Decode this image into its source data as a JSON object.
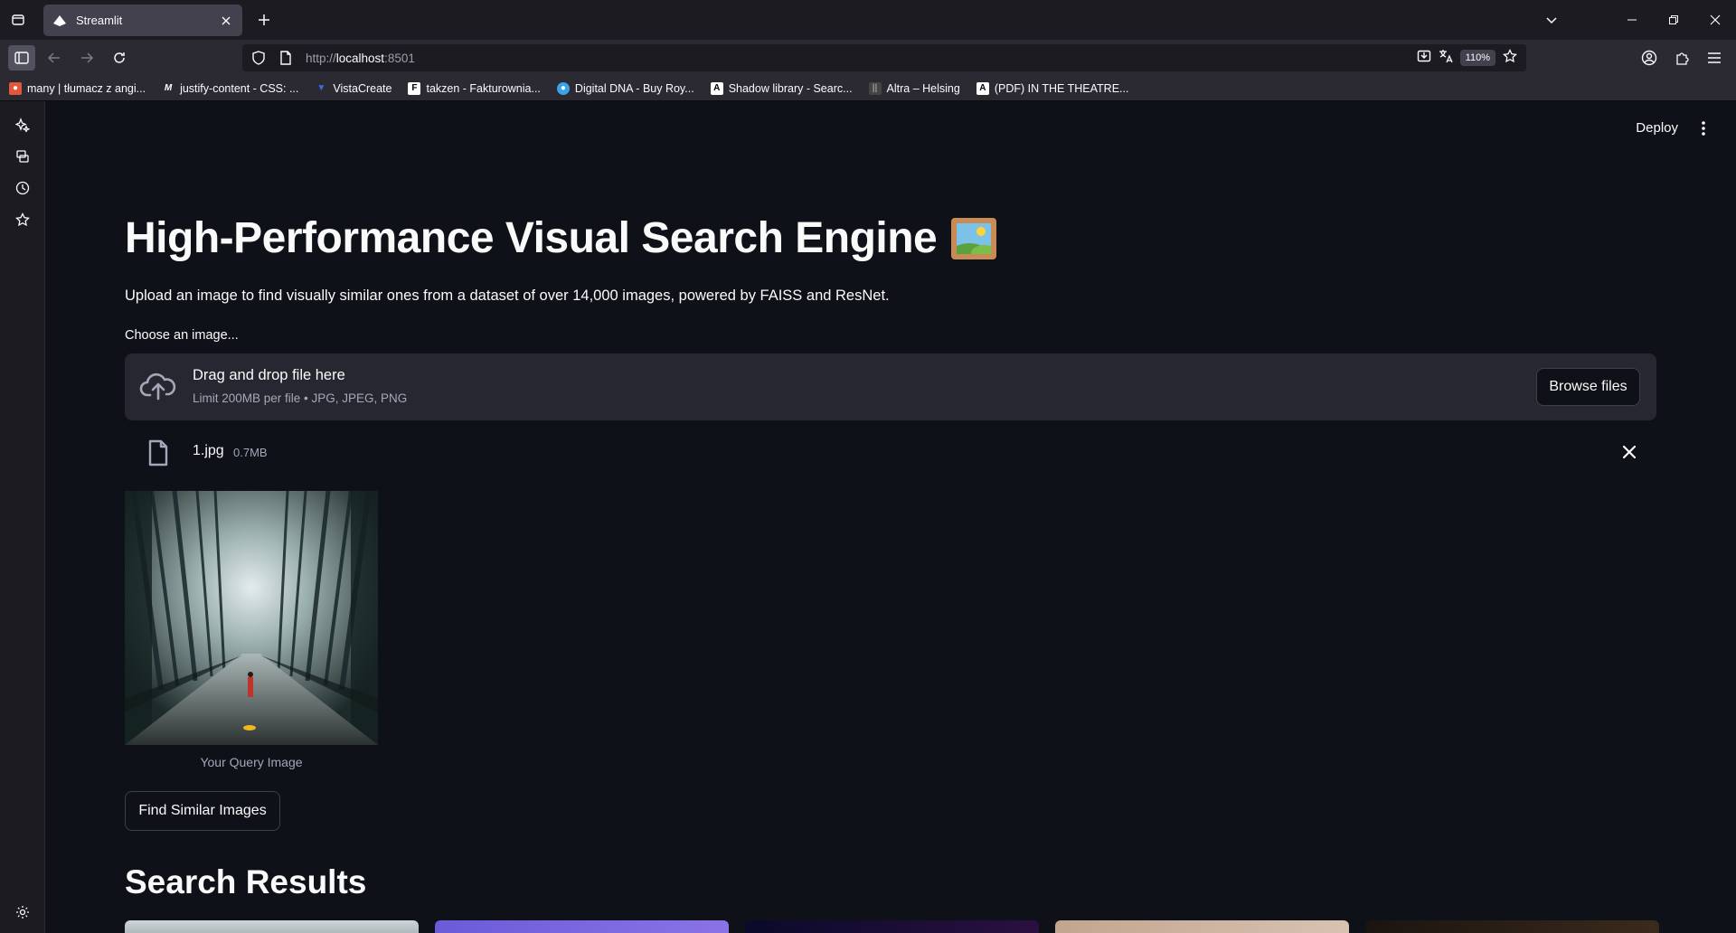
{
  "browser": {
    "tab_title": "Streamlit",
    "url_host": "http://",
    "url_main": "localhost",
    "url_port": ":8501",
    "zoom": "110%",
    "bookmarks": [
      {
        "label": "many | tłumacz z angi...",
        "color": "#e2563b"
      },
      {
        "label": "justify-content - CSS: ...",
        "color": "#ffffff"
      },
      {
        "label": "VistaCreate",
        "color": "#2f6fea"
      },
      {
        "label": "takzen - Fakturownia...",
        "color": "#ffffff"
      },
      {
        "label": "Digital DNA - Buy Roy...",
        "color": "#3aa3e8"
      },
      {
        "label": "Shadow library - Searc...",
        "color": "#ffffff"
      },
      {
        "label": "Altra – Helsing",
        "color": "#444444"
      },
      {
        "label": "(PDF) IN THE THEATRE...",
        "color": "#ffffff"
      }
    ]
  },
  "app": {
    "deploy_label": "Deploy",
    "title": "High-Performance Visual Search Engine",
    "title_emoji": "framed-picture-icon",
    "subtitle": "Upload an image to find visually similar ones from a dataset of over 14,000 images, powered by FAISS and ResNet.",
    "uploader": {
      "label": "Choose an image...",
      "drop_title": "Drag and drop file here",
      "drop_sub": "Limit 200MB per file • JPG, JPEG, PNG",
      "browse_label": "Browse files"
    },
    "file": {
      "name": "1.jpg",
      "size": "0.7MB"
    },
    "query_caption": "Your Query Image",
    "find_button": "Find Similar Images",
    "results_heading": "Search Results"
  },
  "colors": {
    "app_bg": "#0e1117",
    "widget_bg": "#262730",
    "muted_text": "#a3a8b8",
    "browser_chrome": "#2b2a33"
  }
}
